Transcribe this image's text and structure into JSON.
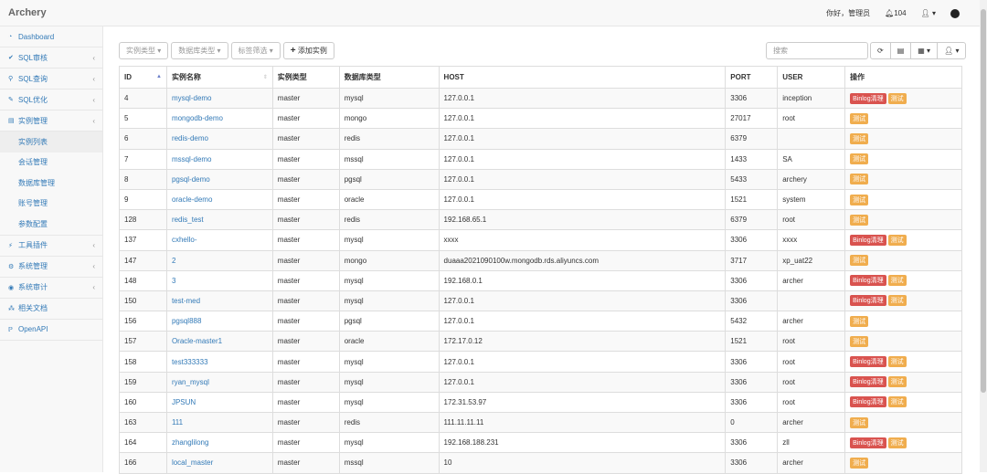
{
  "app": {
    "title": "Archery"
  },
  "topbar": {
    "greeting": "你好，管理员",
    "notifications": "104",
    "bell_icon": "bell-icon",
    "user_icon": "user-icon",
    "github_icon": "github-icon"
  },
  "sidebar": {
    "items": [
      {
        "label": "Dashboard",
        "icon": "dashboard-icon",
        "chev": false
      },
      {
        "label": "SQL审核",
        "icon": "check-icon",
        "chev": true
      },
      {
        "label": "SQL查询",
        "icon": "search-icon",
        "chev": true
      },
      {
        "label": "SQL优化",
        "icon": "wrench-icon",
        "chev": true
      },
      {
        "label": "实例管理",
        "icon": "database-icon",
        "chev": true
      }
    ],
    "subitems": [
      "实例列表",
      "会话管理",
      "数据库管理",
      "账号管理",
      "参数配置"
    ],
    "items2": [
      {
        "label": "工具插件",
        "icon": "plug-icon",
        "chev": true
      },
      {
        "label": "系统管理",
        "icon": "gears-icon",
        "chev": true
      },
      {
        "label": "系统审计",
        "icon": "eye-icon",
        "chev": true
      },
      {
        "label": "相关文档",
        "icon": "sitemap-icon",
        "chev": false
      },
      {
        "label": "OpenAPI",
        "icon": "api-icon",
        "chev": false
      }
    ]
  },
  "toolbar": {
    "instance_type": "实例类型",
    "db_type": "数据库类型",
    "tag_filter": "标签筛选",
    "add": "添加实例",
    "search_placeholder": "搜索"
  },
  "table": {
    "headers": [
      "ID",
      "实例名称",
      "实例类型",
      "数据库类型",
      "HOST",
      "PORT",
      "USER",
      "操作"
    ],
    "binlog_label": "Binlog清理",
    "test_label": "测试",
    "rows": [
      {
        "id": "4",
        "name": "mysql-demo",
        "type": "master",
        "db": "mysql",
        "host": "127.0.0.1",
        "port": "3306",
        "user": "inception",
        "binlog": true
      },
      {
        "id": "5",
        "name": "mongodb-demo",
        "type": "master",
        "db": "mongo",
        "host": "127.0.0.1",
        "port": "27017",
        "user": "root",
        "binlog": false
      },
      {
        "id": "6",
        "name": "redis-demo",
        "type": "master",
        "db": "redis",
        "host": "127.0.0.1",
        "port": "6379",
        "user": "",
        "binlog": false
      },
      {
        "id": "7",
        "name": "mssql-demo",
        "type": "master",
        "db": "mssql",
        "host": "127.0.0.1",
        "port": "1433",
        "user": "SA",
        "binlog": false
      },
      {
        "id": "8",
        "name": "pgsql-demo",
        "type": "master",
        "db": "pgsql",
        "host": "127.0.0.1",
        "port": "5433",
        "user": "archery",
        "binlog": false
      },
      {
        "id": "9",
        "name": "oracle-demo",
        "type": "master",
        "db": "oracle",
        "host": "127.0.0.1",
        "port": "1521",
        "user": "system",
        "binlog": false
      },
      {
        "id": "128",
        "name": "redis_test",
        "type": "master",
        "db": "redis",
        "host": "192.168.65.1",
        "port": "6379",
        "user": "root",
        "binlog": false
      },
      {
        "id": "137",
        "name": "cxhello-",
        "type": "master",
        "db": "mysql",
        "host": "xxxx",
        "port": "3306",
        "user": "xxxx",
        "binlog": true
      },
      {
        "id": "147",
        "name": "2",
        "type": "master",
        "db": "mongo",
        "host": "duaaa2021090100w.mongodb.rds.aliyuncs.com",
        "port": "3717",
        "user": "xp_uat22",
        "binlog": false
      },
      {
        "id": "148",
        "name": "3",
        "type": "master",
        "db": "mysql",
        "host": "192.168.0.1",
        "port": "3306",
        "user": "archer",
        "binlog": true
      },
      {
        "id": "150",
        "name": "test-med",
        "type": "master",
        "db": "mysql",
        "host": "127.0.0.1",
        "port": "3306",
        "user": "",
        "binlog": true
      },
      {
        "id": "156",
        "name": "pgsql888",
        "type": "master",
        "db": "pgsql",
        "host": "127.0.0.1",
        "port": "5432",
        "user": "archer",
        "binlog": false
      },
      {
        "id": "157",
        "name": "Oracle-master1",
        "type": "master",
        "db": "oracle",
        "host": "172.17.0.12",
        "port": "1521",
        "user": "root",
        "binlog": false
      },
      {
        "id": "158",
        "name": "test333333",
        "type": "master",
        "db": "mysql",
        "host": "127.0.0.1",
        "port": "3306",
        "user": "root",
        "binlog": true
      },
      {
        "id": "159",
        "name": "ryan_mysql",
        "type": "master",
        "db": "mysql",
        "host": "127.0.0.1",
        "port": "3306",
        "user": "root",
        "binlog": true
      },
      {
        "id": "160",
        "name": "JPSUN",
        "type": "master",
        "db": "mysql",
        "host": "172.31.53.97",
        "port": "3306",
        "user": "root",
        "binlog": true
      },
      {
        "id": "163",
        "name": "111",
        "type": "master",
        "db": "redis",
        "host": "111.11.11.11",
        "port": "0",
        "user": "archer",
        "binlog": false
      },
      {
        "id": "164",
        "name": "zhanglilong",
        "type": "master",
        "db": "mysql",
        "host": "192.168.188.231",
        "port": "3306",
        "user": "zll",
        "binlog": true
      },
      {
        "id": "166",
        "name": "local_master",
        "type": "master",
        "db": "mssql",
        "host": "10",
        "port": "3306",
        "user": "archer",
        "binlog": false
      }
    ]
  }
}
